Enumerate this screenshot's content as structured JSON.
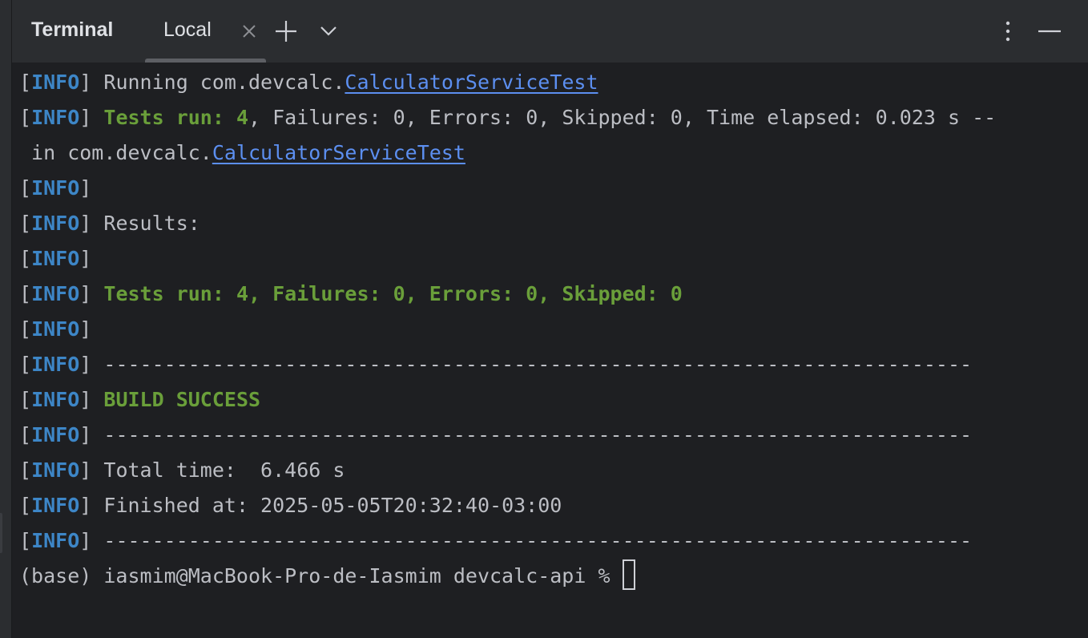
{
  "header": {
    "title": "Terminal",
    "tabs": [
      {
        "label": "Local",
        "active": true
      }
    ]
  },
  "icons": {
    "close": "close-icon",
    "add": "plus-icon",
    "dropdown": "chevron-down-icon",
    "more": "more-vertical-icon",
    "minimize": "minimize-icon"
  },
  "colors": {
    "background": "#1e1f22",
    "header": "#2b2d30",
    "info": "#3d86c7",
    "success": "#6a9f3a",
    "link": "#5c8ff0"
  },
  "terminal": {
    "info_tag": "INFO",
    "lines": {
      "l1_text": "Running com.devcalc.",
      "l1_link": "CalculatorServiceTest",
      "l2_green": "Tests run: 4",
      "l2_text": ", Failures: 0, Errors: 0, Skipped: 0, Time elapsed: 0.023 s --",
      "l3_text": " in com.devcalc.",
      "l3_link": "CalculatorServiceTest",
      "l5_text": "Results:",
      "l7_green": "Tests run: 4, Failures: 0, Errors: 0, Skipped: 0",
      "l9_text": "------------------------------------------------------------------------",
      "l10_green": "BUILD SUCCESS",
      "l11_text": "------------------------------------------------------------------------",
      "l12_text": "Total time:  6.466 s",
      "l13_text": "Finished at: 2025-05-05T20:32:40-03:00",
      "l14_text": "------------------------------------------------------------------------",
      "prompt": "(base) iasmim@MacBook-Pro-de-Iasmim devcalc-api % "
    }
  }
}
